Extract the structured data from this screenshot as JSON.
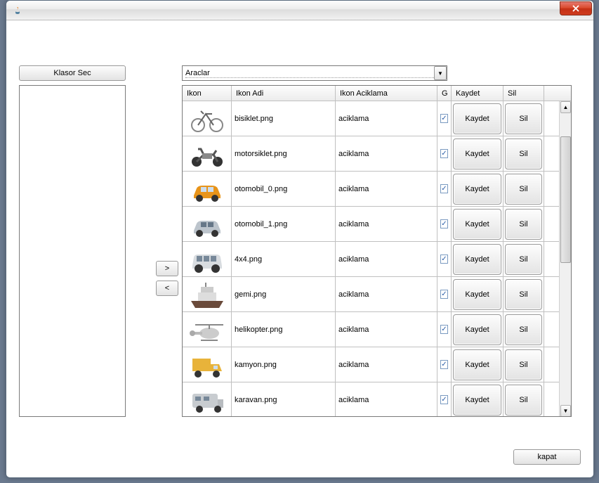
{
  "window": {
    "title": ""
  },
  "buttons": {
    "folder": "Klasor Sec",
    "right": ">",
    "left": "<",
    "close": "kapat"
  },
  "combo": {
    "selected": "Araclar"
  },
  "table": {
    "headers": {
      "icon": "Ikon",
      "name": "Ikon Adi",
      "desc": "Ikon Aciklama",
      "g": "G",
      "kaydet": "Kaydet",
      "sil": "Sil"
    },
    "row_buttons": {
      "save": "Kaydet",
      "delete": "Sil"
    },
    "rows": [
      {
        "icon": "bicycle-icon",
        "name": "bisiklet.png",
        "desc": "aciklama",
        "checked": true
      },
      {
        "icon": "motorcycle-icon",
        "name": "motorsiklet.png",
        "desc": "aciklama",
        "checked": true
      },
      {
        "icon": "car-orange-icon",
        "name": "otomobil_0.png",
        "desc": "aciklama",
        "checked": true
      },
      {
        "icon": "car-silver-icon",
        "name": "otomobil_1.png",
        "desc": "aciklama",
        "checked": true
      },
      {
        "icon": "suv-icon",
        "name": "4x4.png",
        "desc": "aciklama",
        "checked": true
      },
      {
        "icon": "ship-icon",
        "name": "gemi.png",
        "desc": "aciklama",
        "checked": true
      },
      {
        "icon": "helicopter-icon",
        "name": "helikopter.png",
        "desc": "aciklama",
        "checked": true
      },
      {
        "icon": "truck-icon",
        "name": "kamyon.png",
        "desc": "aciklama",
        "checked": true
      },
      {
        "icon": "caravan-icon",
        "name": "karavan.png",
        "desc": "aciklama",
        "checked": true
      }
    ]
  }
}
